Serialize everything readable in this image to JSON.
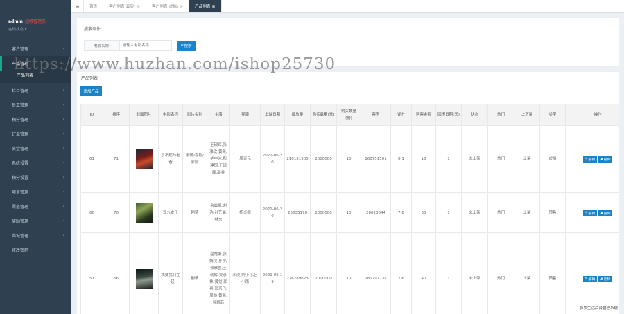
{
  "user": {
    "name": "admin",
    "role": "超级管理员",
    "status": "在线状态"
  },
  "sidebar": {
    "items": [
      {
        "label": "客户管理"
      },
      {
        "label": "产品管理"
      },
      {
        "label": "栏目管理"
      },
      {
        "label": "员工管理"
      },
      {
        "label": "积分管理"
      },
      {
        "label": "订单管理"
      },
      {
        "label": "资金管理"
      },
      {
        "label": "系统设置"
      },
      {
        "label": "积分设置"
      },
      {
        "label": "项目管理"
      },
      {
        "label": "渠道管理"
      },
      {
        "label": "奖励管理"
      },
      {
        "label": "商城管理"
      },
      {
        "label": "修改密码"
      }
    ],
    "submenu": [
      {
        "label": "产品列表"
      }
    ]
  },
  "tabs": [
    {
      "label": "首页"
    },
    {
      "label": "客户列表(真实)"
    },
    {
      "label": "客户列表(虚拟)"
    },
    {
      "label": "产品列表"
    }
  ],
  "search": {
    "title": "搜索条件",
    "label": "电影名称:",
    "placeholder": "请输入电影名称",
    "button": "搜索"
  },
  "list": {
    "title": "产品列表",
    "add_button": "添加产品",
    "columns": [
      "ID",
      "排序",
      "封面图片",
      "电影名称",
      "影片类别",
      "主演",
      "导演",
      "上映日期",
      "播放量",
      "购买数量(元)",
      "购买数量(份)",
      "票房",
      "评分",
      "购票金额",
      "回报日期(天)",
      "状态",
      "热门",
      "上下架",
      "类型",
      "操作"
    ],
    "rows": [
      {
        "id": "61",
        "sort": "71",
        "name": "了不起的老爸",
        "genre": "剧情/喜剧/家庭",
        "actors": "王砚辉,张雅玫,黄尧,毕中沐,和建国,王砚辉,邵兵",
        "director": "周青元",
        "date": "2021-06-20",
        "plays": "210151505",
        "amount": "2000000",
        "shares": "10",
        "box": "160751501",
        "rating": "8.1",
        "price": "18",
        "days": "1",
        "status": "未上架",
        "hot": "热门",
        "shelf": "上架",
        "type": "虚拟"
      },
      {
        "id": "60",
        "sort": "70",
        "name": "双九女子",
        "genre": "剧情",
        "actors": "余燊帆,刘浩,孙艺晨,林东",
        "director": "杨贞妮",
        "date": "2021-06-20",
        "plays": "25635178",
        "amount": "2000000",
        "shares": "10",
        "box": "28623044",
        "rating": "7.8",
        "price": "35",
        "days": "1",
        "status": "未上架",
        "hot": "热门",
        "shelf": "上架",
        "type": "预售"
      },
      {
        "id": "57",
        "sort": "66",
        "name": "我要我们在一起",
        "genre": "剧情",
        "actors": "屈楚萧,张婧仪,孙宁,张雅萱,王砚辉,吴彦姝,黄觉,邵兵,郭京飞,周游,黄尧,徐颢菲",
        "director": "沙漠,刘小花,吕小雨",
        "date": "2021-06-19",
        "plays": "276289623",
        "amount": "2000000",
        "shares": "10",
        "box": "281297735",
        "rating": "7.6",
        "price": "40",
        "days": "1",
        "status": "未上架",
        "hot": "热门",
        "shelf": "上架",
        "type": "预售"
      }
    ],
    "edit_label": "编辑",
    "delete_label": "删除"
  },
  "footer": "影票生活后台管理系统",
  "watermark": "https://www.huzhan.com/ishop25730",
  "colors": {
    "sidebar": "#2f4050",
    "primary": "#1c84c6",
    "active_tab": "#2f4050"
  }
}
